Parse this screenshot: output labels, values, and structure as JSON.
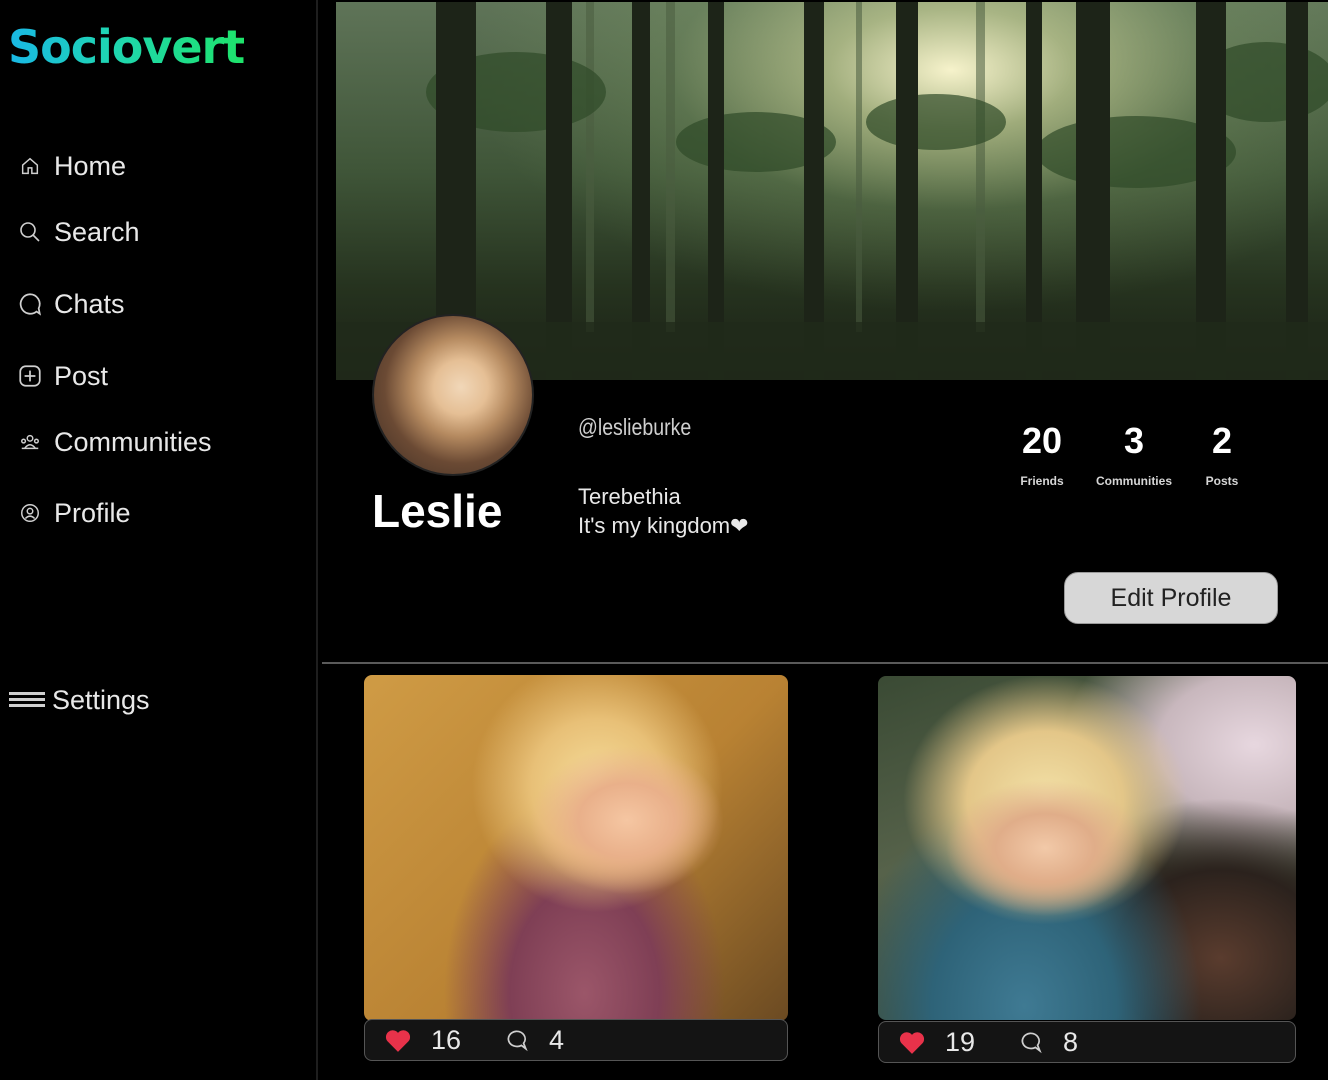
{
  "app": {
    "logo": "Sociovert"
  },
  "sidebar": {
    "items": [
      {
        "label": "Home",
        "icon": "home-icon"
      },
      {
        "label": "Search",
        "icon": "search-icon"
      },
      {
        "label": "Chats",
        "icon": "chat-icon"
      },
      {
        "label": "Post",
        "icon": "plus-square-icon"
      },
      {
        "label": "Communities",
        "icon": "communities-icon"
      },
      {
        "label": "Profile",
        "icon": "profile-icon"
      }
    ],
    "settings": {
      "label": "Settings",
      "icon": "menu-icon"
    }
  },
  "profile": {
    "name": "Leslie",
    "handle": "@leslieburke",
    "bio_line1": "Terebethia",
    "bio_line2": "It's my kingdom❤",
    "stats": [
      {
        "value": "20",
        "label": "Friends"
      },
      {
        "value": "3",
        "label": "Communities"
      },
      {
        "value": "2",
        "label": "Posts"
      }
    ],
    "edit_label": "Edit Profile"
  },
  "posts": [
    {
      "likes": "16",
      "comments": "4"
    },
    {
      "likes": "19",
      "comments": "8"
    }
  ],
  "colors": {
    "background": "#000000",
    "logo_start": "#19b8e6",
    "logo_end": "#1ee36a",
    "heart": "#e8324a",
    "button_bg": "#d7d7d7"
  }
}
